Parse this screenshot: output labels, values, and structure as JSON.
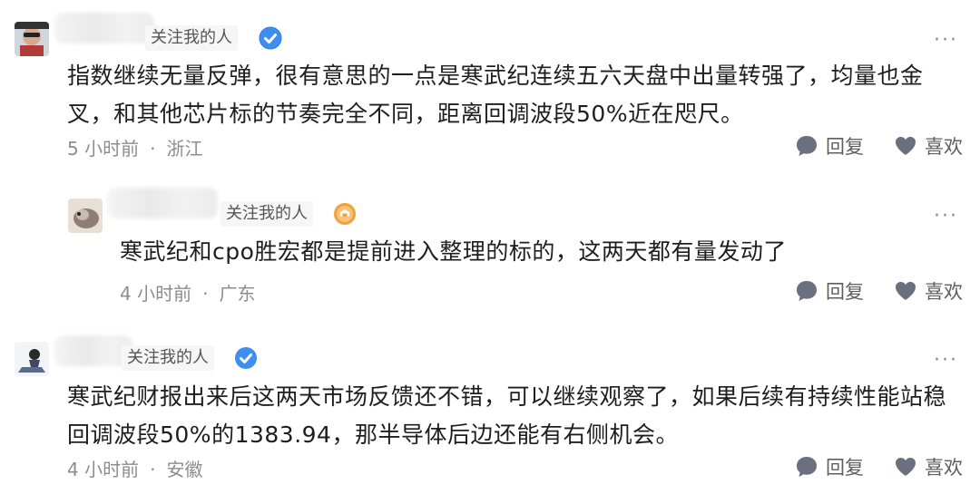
{
  "comments": [
    {
      "follow_tag": "关注我的人",
      "badge": "blue-verified",
      "content_lines": [
        "指数继续无量反弹，很有意思的一点是寒武纪连续五六天盘中出量转强了，均量也金",
        "叉，和其他芯片标的节奏完全不同，距离回调波段50%近在咫尺。"
      ],
      "time": "5 小时前",
      "location": "浙江",
      "reply_label": "回复",
      "like_label": "喜欢"
    },
    {
      "follow_tag": "关注我的人",
      "badge": "orange-level",
      "content_lines": [
        "寒武纪和cpo胜宏都是提前进入整理的标的，这两天都有量发动了"
      ],
      "time": "4 小时前",
      "location": "广东",
      "reply_label": "回复",
      "like_label": "喜欢"
    },
    {
      "follow_tag": "关注我的人",
      "badge": "blue-verified",
      "content_lines": [
        "寒武纪财报出来后这两天市场反馈还不错，可以继续观察了，如果后续有持续性能站稳",
        "回调波段50%的1383.94，那半导体后边还能有右侧机会。"
      ],
      "time": "4 小时前",
      "location": "安徽",
      "reply_label": "回复",
      "like_label": "喜欢"
    }
  ],
  "more_symbol": "···",
  "dot_symbol": "·",
  "colors": {
    "verified_blue": "#3d8ef0",
    "level_orange": "#f0a13a",
    "action_gray": "#6b6f80"
  }
}
